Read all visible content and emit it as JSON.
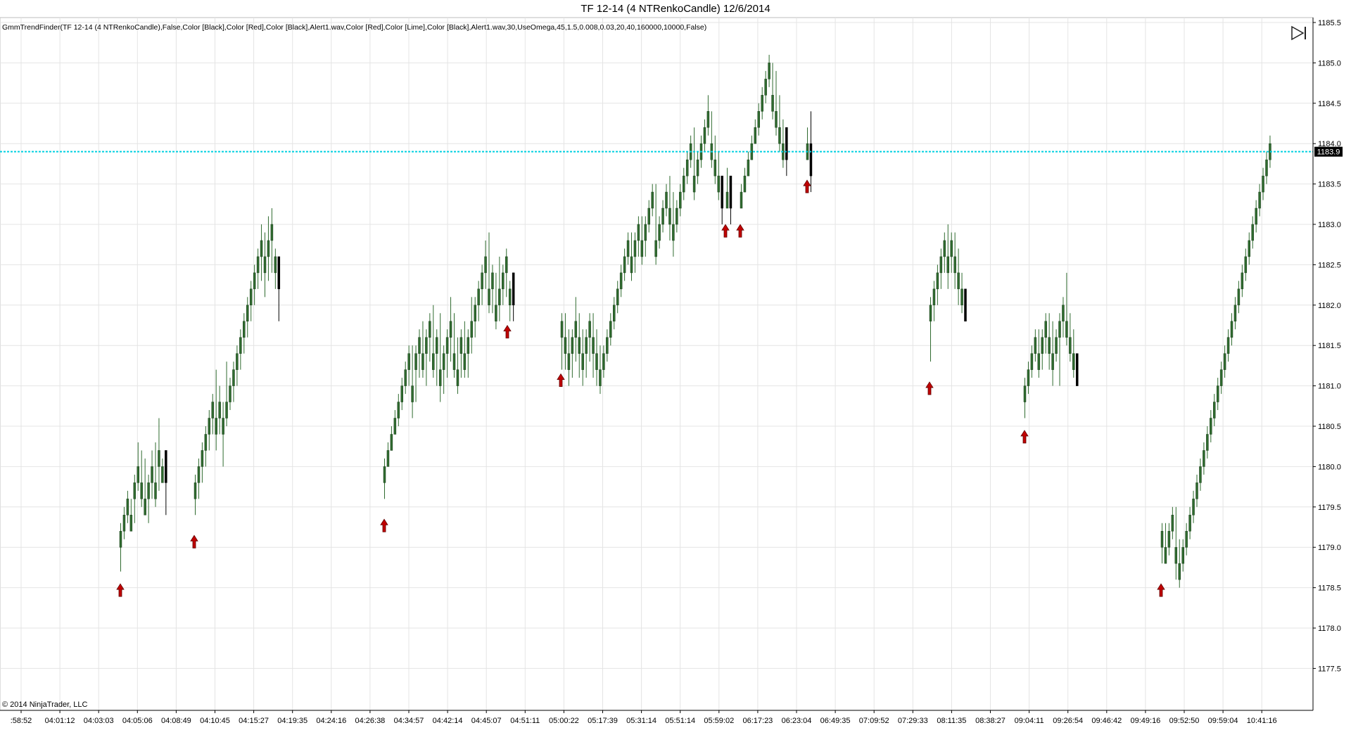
{
  "window": {
    "title": "TF 12-14 (4 NTRenkoCandle)  12/6/2014",
    "indicator_label": "GmmTrendFinder(TF 12-14 (4 NTRenkoCandle),False,Color [Black],Color [Red],Color [Black],Alert1.wav,Color [Red],Color [Lime],Color [Black],Alert1.wav,30,UseOmega,45,1.5,0.008,0.03,20,40,160000,10000,False)",
    "copyright": "© 2014 NinjaTrader, LLC",
    "play_icon": "play-step-icon"
  },
  "colors": {
    "up_bar": "#2f6b2f",
    "down_bar": "#000000",
    "arrow": "#c00000",
    "price_line": "#00d0e0",
    "grid": "#e4e4e4",
    "price_tag_bg": "#000000"
  },
  "chart_data": {
    "type": "candlestick",
    "instrument": "TF 12-14",
    "bar_type": "4 NTRenkoCandle",
    "date": "12/6/2014",
    "ylim": [
      1177.2,
      1185.6
    ],
    "y_ticks": [
      1177.5,
      1178.0,
      1178.5,
      1179.0,
      1179.5,
      1180.0,
      1180.5,
      1181.0,
      1181.5,
      1182.0,
      1182.5,
      1183.0,
      1183.5,
      1184.0,
      1184.5,
      1185.0,
      1185.5
    ],
    "y_tick_labels": [
      "1177.5",
      "1178.0",
      "1178.5",
      "1179.0",
      "1179.5",
      "1180.0",
      "1180.5",
      "1181.0",
      "1181.5",
      "1182.0",
      "1182.5",
      "1183.0",
      "1183.5",
      "1184.0",
      "1184.5",
      "1185.0",
      "1185.5"
    ],
    "x_tick_labels": [
      ":58:52",
      "04:01:12",
      "04:03:03",
      "04:05:06",
      "04:08:49",
      "04:10:45",
      "04:15:27",
      "04:19:35",
      "04:24:16",
      "04:26:38",
      "04:34:57",
      "04:42:14",
      "04:45:07",
      "04:51:11",
      "05:00:22",
      "05:17:39",
      "05:31:14",
      "05:51:14",
      "05:59:02",
      "06:17:23",
      "06:23:04",
      "06:49:35",
      "07:09:52",
      "07:29:33",
      "08:11:35",
      "08:38:27",
      "09:04:11",
      "09:26:54",
      "09:46:42",
      "09:49:16",
      "09:52:50",
      "09:59:04",
      "10:41:16"
    ],
    "current_price": 1183.9,
    "current_price_label": "1183.9",
    "segments": [
      {
        "start": 170,
        "closes": [
          1179.2,
          1179.4,
          1179.6,
          1179.4,
          1179.8,
          1180.0,
          1179.8,
          1179.6,
          1179.8,
          1180.0,
          1179.8,
          1180.2,
          1180.0,
          1179.8
        ],
        "highs": [
          1179.3,
          1179.5,
          1179.7,
          1179.6,
          1179.9,
          1180.3,
          1180.2,
          1180.1,
          1179.9,
          1180.2,
          1180.3,
          1180.6,
          1180.1,
          1179.9
        ],
        "lows": [
          1178.7,
          1179.1,
          1179.3,
          1179.3,
          1179.3,
          1179.7,
          1179.5,
          1179.5,
          1179.3,
          1179.6,
          1179.5,
          1179.7,
          1179.8,
          1179.4
        ],
        "last_down": 1
      },
      {
        "start": 276,
        "closes": [
          1179.8,
          1180.0,
          1180.2,
          1180.4,
          1180.6,
          1180.8,
          1180.6,
          1180.8,
          1180.6,
          1180.8,
          1181.0,
          1181.2,
          1181.4,
          1181.6,
          1181.8,
          1182.0,
          1182.2,
          1182.4,
          1182.6,
          1182.8,
          1182.6,
          1182.8,
          1183.0,
          1182.6,
          1182.2
        ],
        "highs": [
          1179.9,
          1180.1,
          1180.3,
          1180.5,
          1180.7,
          1180.9,
          1181.2,
          1181.0,
          1180.8,
          1181.3,
          1181.1,
          1181.3,
          1181.5,
          1181.7,
          1181.9,
          1182.1,
          1182.3,
          1182.5,
          1182.7,
          1183.0,
          1182.9,
          1183.1,
          1183.2,
          1182.7,
          1182.3
        ],
        "lows": [
          1179.4,
          1179.6,
          1179.8,
          1180.0,
          1180.2,
          1180.4,
          1180.2,
          1180.4,
          1180.0,
          1180.5,
          1180.7,
          1180.8,
          1181.0,
          1181.2,
          1181.4,
          1181.6,
          1181.8,
          1182.0,
          1182.2,
          1182.3,
          1182.1,
          1182.3,
          1182.4,
          1182.2,
          1181.8
        ],
        "last_down": 1
      },
      {
        "start": 545,
        "closes": [
          1180.0,
          1180.2,
          1180.4,
          1180.6,
          1180.8,
          1181.0,
          1181.2,
          1181.4,
          1181.0,
          1181.4,
          1181.6,
          1181.4,
          1181.6,
          1181.8,
          1181.4,
          1181.6,
          1181.2,
          1181.4,
          1181.6,
          1181.8,
          1181.4,
          1181.2,
          1181.6,
          1181.4,
          1181.6,
          1181.8,
          1182.0,
          1182.2,
          1182.4,
          1182.6,
          1182.2,
          1182.4,
          1182.0,
          1182.2,
          1182.4,
          1182.6,
          1182.2,
          1182.0
        ],
        "highs": [
          1180.1,
          1180.3,
          1180.5,
          1180.7,
          1180.9,
          1181.1,
          1181.3,
          1181.5,
          1181.5,
          1181.5,
          1181.7,
          1181.8,
          1181.7,
          1181.9,
          1182.0,
          1181.7,
          1181.9,
          1181.5,
          1181.7,
          1182.1,
          1181.9,
          1181.6,
          1181.7,
          1181.8,
          1181.7,
          1182.1,
          1182.1,
          1182.3,
          1182.5,
          1182.8,
          1182.9,
          1182.5,
          1182.4,
          1182.6,
          1182.5,
          1182.7,
          1182.3,
          1182.1
        ],
        "lows": [
          1179.6,
          1180.0,
          1180.2,
          1180.4,
          1180.5,
          1180.7,
          1180.9,
          1181.0,
          1180.6,
          1180.8,
          1181.1,
          1181.1,
          1181.0,
          1181.3,
          1181.1,
          1181.0,
          1180.8,
          1180.9,
          1181.1,
          1181.3,
          1181.1,
          1180.9,
          1181.1,
          1181.1,
          1181.1,
          1181.4,
          1181.6,
          1181.8,
          1182.0,
          1182.2,
          1181.9,
          1181.9,
          1181.7,
          1181.8,
          1182.0,
          1182.1,
          1181.8,
          1181.8
        ],
        "last_down": 1
      },
      {
        "start": 797,
        "closes": [
          1181.8,
          1181.6,
          1181.4,
          1181.6,
          1181.8,
          1181.6,
          1181.4,
          1181.6,
          1181.8,
          1181.6,
          1181.4,
          1181.2,
          1181.4,
          1181.6,
          1181.8,
          1182.0,
          1182.2,
          1182.4,
          1182.6,
          1182.8,
          1182.6,
          1182.8,
          1183.0,
          1182.8,
          1183.0,
          1183.2,
          1183.4,
          1182.8,
          1183.0,
          1183.2,
          1183.4,
          1183.2,
          1183.0,
          1183.2,
          1183.4,
          1183.6,
          1183.8,
          1184.0,
          1183.6,
          1183.8,
          1184.0,
          1184.2,
          1184.4,
          1184.0,
          1183.8,
          1183.6,
          1183.2
        ],
        "highs": [
          1181.9,
          1181.9,
          1181.7,
          1181.7,
          1182.1,
          1181.9,
          1181.7,
          1181.7,
          1181.9,
          1181.9,
          1181.7,
          1181.5,
          1181.5,
          1181.7,
          1181.9,
          1182.1,
          1182.3,
          1182.5,
          1182.7,
          1182.9,
          1182.9,
          1182.9,
          1183.1,
          1183.1,
          1183.1,
          1183.3,
          1183.5,
          1183.5,
          1183.1,
          1183.3,
          1183.5,
          1183.6,
          1183.4,
          1183.3,
          1183.5,
          1183.7,
          1183.9,
          1184.1,
          1184.2,
          1183.9,
          1184.1,
          1184.3,
          1184.6,
          1184.4,
          1184.1,
          1183.9,
          1183.6
        ],
        "lows": [
          1181.2,
          1181.2,
          1181.0,
          1181.1,
          1181.3,
          1181.1,
          1181.0,
          1181.1,
          1181.3,
          1181.1,
          1181.0,
          1180.9,
          1181.1,
          1181.3,
          1181.5,
          1181.7,
          1181.9,
          1182.1,
          1182.3,
          1182.5,
          1182.3,
          1182.4,
          1182.6,
          1182.5,
          1182.6,
          1182.9,
          1183.1,
          1182.5,
          1182.7,
          1182.9,
          1183.1,
          1182.8,
          1182.6,
          1182.9,
          1183.1,
          1183.3,
          1183.5,
          1183.7,
          1183.3,
          1183.5,
          1183.7,
          1183.9,
          1184.1,
          1183.7,
          1183.5,
          1183.3,
          1183.0
        ],
        "last_down": 1
      },
      {
        "start": 1032,
        "closes": [
          1183.4,
          1183.2
        ],
        "highs": [
          1183.7,
          1183.5
        ],
        "lows": [
          1183.2,
          1183.0
        ],
        "last_down": 1
      },
      {
        "start": 1052,
        "closes": [
          1183.4,
          1183.6,
          1183.8,
          1184.0,
          1184.2,
          1184.4,
          1184.6,
          1184.8,
          1185.0,
          1184.6,
          1184.4,
          1184.2,
          1184.0,
          1183.8
        ],
        "highs": [
          1183.5,
          1183.7,
          1183.9,
          1184.1,
          1184.3,
          1184.5,
          1184.7,
          1184.9,
          1185.1,
          1185.0,
          1184.9,
          1184.6,
          1184.3,
          1184.0
        ],
        "lows": [
          1183.2,
          1183.4,
          1183.6,
          1183.8,
          1184.0,
          1184.1,
          1184.3,
          1184.5,
          1184.7,
          1184.3,
          1184.1,
          1183.9,
          1183.7,
          1183.6
        ],
        "last_down": 1
      },
      {
        "start": 1146,
        "closes": [
          1184.0,
          1183.6
        ],
        "highs": [
          1184.2,
          1184.4
        ],
        "lows": [
          1183.8,
          1183.4
        ],
        "last_down": 1
      },
      {
        "start": 1321,
        "closes": [
          1182.0,
          1182.2,
          1182.4,
          1182.6,
          1182.8,
          1182.6,
          1182.8,
          1182.6,
          1182.4,
          1182.2,
          1181.8
        ],
        "highs": [
          1182.1,
          1182.3,
          1182.5,
          1182.7,
          1182.9,
          1183.0,
          1182.9,
          1182.9,
          1182.7,
          1182.4,
          1182.2
        ],
        "lows": [
          1181.3,
          1181.8,
          1182.0,
          1182.2,
          1182.4,
          1182.2,
          1182.4,
          1182.2,
          1182.0,
          1181.9,
          1181.8
        ],
        "last_down": 1
      },
      {
        "start": 1455,
        "closes": [
          1181.0,
          1181.2,
          1181.4,
          1181.6,
          1181.4,
          1181.6,
          1181.8,
          1181.6,
          1181.4,
          1181.6,
          1181.8,
          1182.0,
          1181.8,
          1181.6,
          1181.4,
          1181.0
        ],
        "highs": [
          1181.1,
          1181.3,
          1181.5,
          1181.7,
          1181.7,
          1181.7,
          1181.9,
          1181.9,
          1181.8,
          1181.7,
          1181.9,
          1182.1,
          1182.4,
          1181.9,
          1181.7,
          1181.4
        ],
        "lows": [
          1180.6,
          1180.9,
          1181.1,
          1181.3,
          1181.1,
          1181.2,
          1181.4,
          1181.2,
          1181.0,
          1181.3,
          1181.0,
          1181.6,
          1181.5,
          1181.3,
          1181.1,
          1181.0
        ],
        "last_down": 1
      },
      {
        "start": 1650,
        "closes": [
          1179.2,
          1179.0,
          1179.2,
          1179.4,
          1179.0,
          1178.8,
          1179.0,
          1179.2,
          1179.4,
          1179.6,
          1179.8,
          1180.0,
          1180.2,
          1180.4,
          1180.6,
          1180.8,
          1181.0,
          1181.2,
          1181.4,
          1181.6,
          1181.8,
          1182.0,
          1182.2,
          1182.4,
          1182.6,
          1182.8,
          1183.0,
          1183.2,
          1183.4,
          1183.6,
          1183.8,
          1184.0
        ],
        "highs": [
          1179.3,
          1179.3,
          1179.3,
          1179.5,
          1179.5,
          1179.1,
          1179.1,
          1179.3,
          1179.5,
          1179.7,
          1179.9,
          1180.1,
          1180.3,
          1180.5,
          1180.7,
          1180.9,
          1181.1,
          1181.3,
          1181.5,
          1181.7,
          1181.9,
          1182.1,
          1182.3,
          1182.5,
          1182.7,
          1182.9,
          1183.1,
          1183.3,
          1183.5,
          1183.7,
          1183.9,
          1184.1
        ],
        "lows": [
          1178.8,
          1178.8,
          1178.9,
          1179.1,
          1178.6,
          1178.5,
          1178.7,
          1178.9,
          1179.1,
          1179.3,
          1179.5,
          1179.7,
          1179.9,
          1180.1,
          1180.3,
          1180.5,
          1180.7,
          1180.9,
          1181.1,
          1181.3,
          1181.5,
          1181.7,
          1181.9,
          1182.1,
          1182.3,
          1182.5,
          1182.7,
          1182.9,
          1183.1,
          1183.3,
          1183.5,
          1183.7
        ],
        "last_down": 0
      }
    ],
    "signals": [
      {
        "bar_x": 171,
        "price": 1178.4
      },
      {
        "bar_x": 276,
        "price": 1179.0
      },
      {
        "bar_x": 546,
        "price": 1179.2
      },
      {
        "bar_x": 721,
        "price": 1181.6
      },
      {
        "bar_x": 797,
        "price": 1181.0
      },
      {
        "bar_x": 1031,
        "price": 1182.85
      },
      {
        "bar_x": 1052,
        "price": 1182.85
      },
      {
        "bar_x": 1147,
        "price": 1183.4
      },
      {
        "bar_x": 1321,
        "price": 1180.9
      },
      {
        "bar_x": 1456,
        "price": 1180.3
      },
      {
        "bar_x": 1650,
        "price": 1178.4
      }
    ]
  }
}
